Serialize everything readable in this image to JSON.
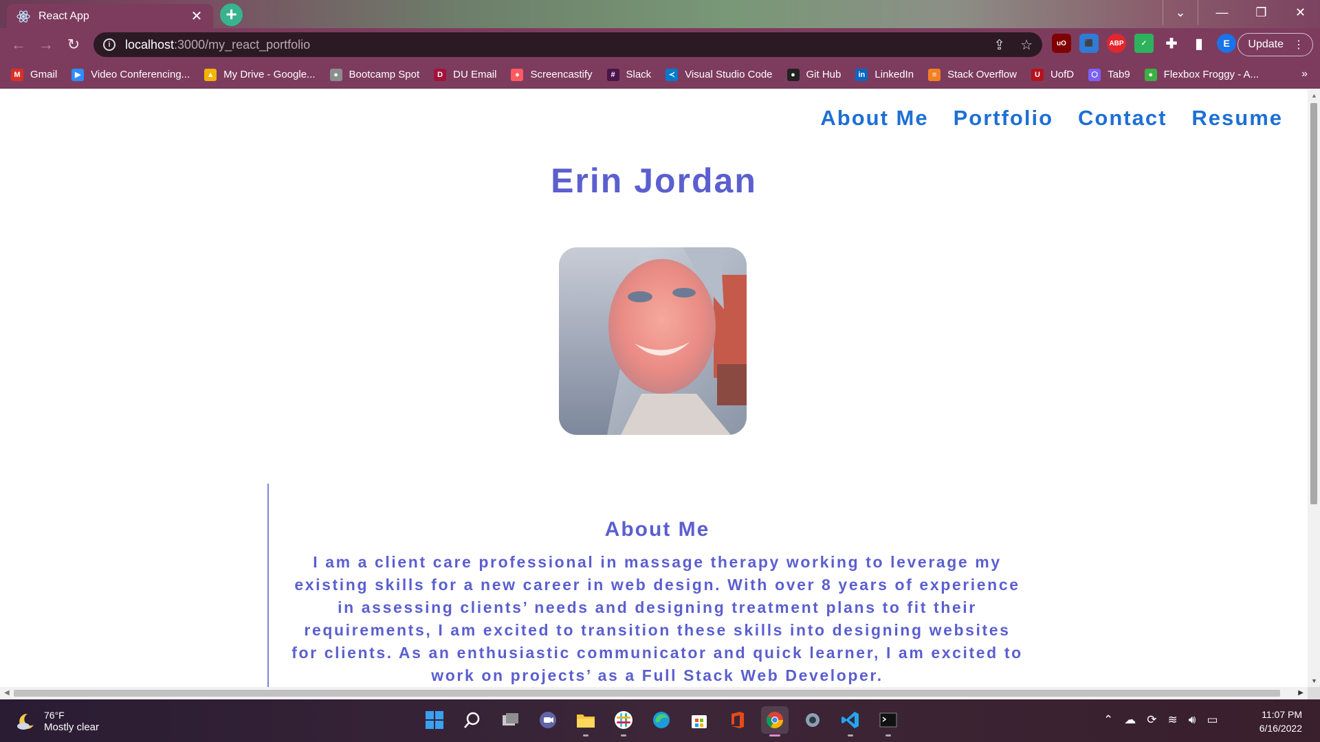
{
  "browser": {
    "tab_title": "React App",
    "tab_close": "✕",
    "new_tab": "+",
    "window_controls": {
      "list": "⌄",
      "minimize": "—",
      "restore": "❐",
      "close": "✕"
    },
    "url_host": "localhost",
    "url_path": ":3000/my_react_portfolio",
    "update_label": "Update",
    "profile_initial": "E",
    "bookmarks": [
      {
        "label": "Gmail",
        "icon": "gmail-icon",
        "color": "#d93025",
        "glyph": "M"
      },
      {
        "label": "Video Conferencing...",
        "icon": "zoom-icon",
        "color": "#2d8cff",
        "glyph": "▶"
      },
      {
        "label": "My Drive - Google...",
        "icon": "drive-icon",
        "color": "#f4b400",
        "glyph": "▲"
      },
      {
        "label": "Bootcamp Spot",
        "icon": "bootcamp-icon",
        "color": "#8d8d8d",
        "glyph": "●"
      },
      {
        "label": "DU Email",
        "icon": "du-icon",
        "color": "#a3123a",
        "glyph": "D"
      },
      {
        "label": "Screencastify",
        "icon": "screencastify-icon",
        "color": "#ff5a5f",
        "glyph": "●"
      },
      {
        "label": "Slack",
        "icon": "slack-icon",
        "color": "#4a154b",
        "glyph": "#"
      },
      {
        "label": "Visual Studio Code",
        "icon": "vscode-icon",
        "color": "#007acc",
        "glyph": "≺"
      },
      {
        "label": "Git Hub",
        "icon": "github-icon",
        "color": "#222222",
        "glyph": "●"
      },
      {
        "label": "LinkedIn",
        "icon": "linkedin-icon",
        "color": "#0a66c2",
        "glyph": "in"
      },
      {
        "label": "Stack Overflow",
        "icon": "stackoverflow-icon",
        "color": "#f48024",
        "glyph": "≡"
      },
      {
        "label": "UofD",
        "icon": "uofd-icon",
        "color": "#b5121b",
        "glyph": "U"
      },
      {
        "label": "Tab9",
        "icon": "tab9-icon",
        "color": "#7b61ff",
        "glyph": "⬡"
      },
      {
        "label": "Flexbox Froggy - A...",
        "icon": "froggy-icon",
        "color": "#3cb043",
        "glyph": "●"
      }
    ],
    "bookmarks_more": "»"
  },
  "site": {
    "nav": [
      "About Me",
      "Portfolio",
      "Contact",
      "Resume"
    ],
    "name": "Erin Jordan",
    "about_title": "About Me",
    "about_text": "I am a client care professional in massage therapy working to leverage my existing skills for a new career in web design. With over 8 years of experience in assessing clients’ needs and designing treatment plans to fit their requirements, I am excited to transition these skills into designing websites for clients. As an enthusiastic communicator and quick learner, I am excited to work on projects’ as a Full Stack Web Developer.",
    "colors": {
      "nav": "#1d6fd6",
      "heading": "#5b5fcf",
      "accent_line": "#7f84d3"
    }
  },
  "taskbar": {
    "temperature": "76°F",
    "condition": "Mostly clear",
    "time": "11:07 PM",
    "date": "6/16/2022"
  }
}
